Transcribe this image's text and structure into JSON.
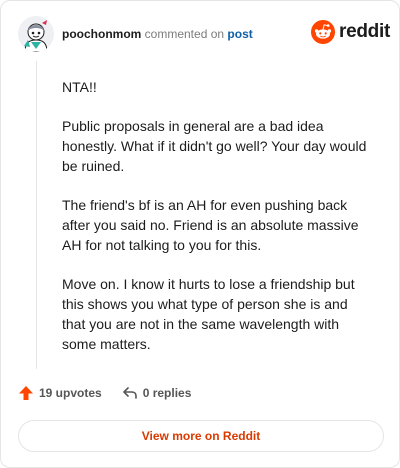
{
  "header": {
    "username": "poochonmom",
    "action_text": "commented on",
    "post_link": "post",
    "brand_name": "reddit",
    "avatar_icon": "snoo-avatar-icon",
    "logo_icon": "reddit-snoo-icon"
  },
  "comment": {
    "paragraphs": [
      "NTA!!",
      "Public proposals in general are a bad idea honestly. What if it didn't go well? Your day would be ruined.",
      "The friend's bf is an AH for even pushing back after you said no. Friend is an absolute massive AH for not talking to you for this.",
      "Move on. I know it hurts to lose a friendship but this shows you what type of person she is and that you are not in the same wavelength with some matters."
    ]
  },
  "actions": {
    "upvotes_label": "19 upvotes",
    "replies_label": "0 replies",
    "upvote_icon": "upvote-arrow-icon",
    "reply_icon": "reply-arrow-icon"
  },
  "footer": {
    "view_more_label": "View more on Reddit"
  },
  "colors": {
    "accent": "#d93a00",
    "brand": "#ff4500",
    "link": "#0f5ea8",
    "text": "#1c1c1c",
    "muted": "#7c7c7c"
  }
}
